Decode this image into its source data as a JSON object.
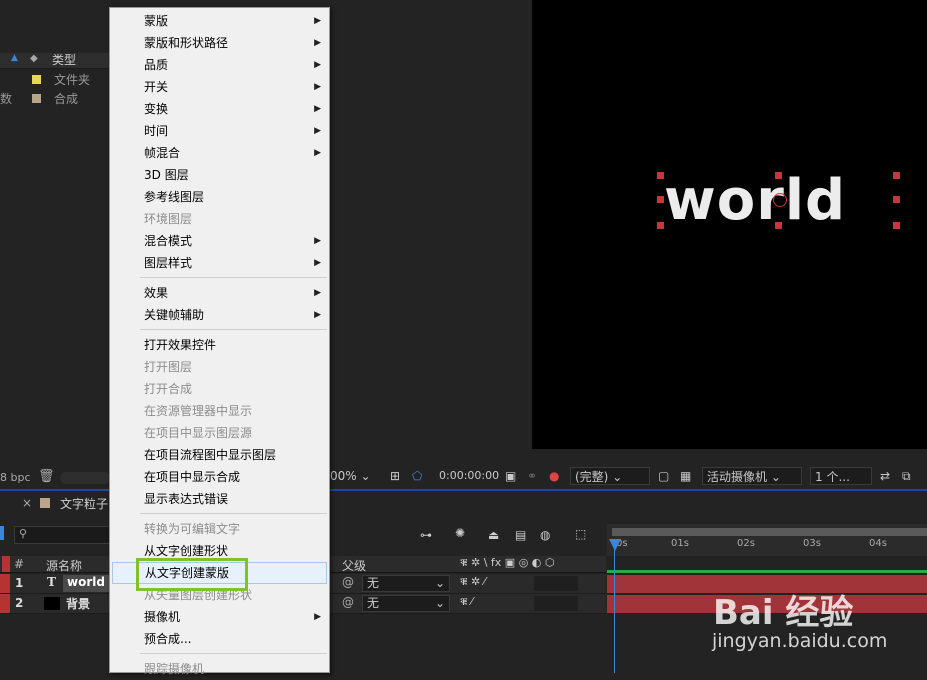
{
  "project_panel": {
    "col_type": "类型",
    "items": [
      {
        "type": "文件夹",
        "color": "#e6d75a"
      },
      {
        "type": "合成",
        "color": "#b8a58a"
      }
    ],
    "bpc": "8 bpc",
    "fragment_left": "数"
  },
  "viewer": {
    "comp_text": "world",
    "zoom_fragment": "00%",
    "timecode": "0:00:00:00",
    "resolution": "(完整)",
    "camera": "活动摄像机",
    "views": "1 个..."
  },
  "timeline": {
    "tab_label": "文字粒子",
    "col_num": "#",
    "col_source": "源名称",
    "col_parent": "父级",
    "layers": [
      {
        "num": "1",
        "type_glyph": "T",
        "name": "world",
        "parent": "无"
      },
      {
        "num": "2",
        "type_glyph": "",
        "name": "背景",
        "parent": "无"
      }
    ],
    "ticks": [
      "0s",
      "01s",
      "02s",
      "03s",
      "04s"
    ]
  },
  "context_menu": {
    "items": [
      {
        "label": "蒙版",
        "submenu": true,
        "disabled": false
      },
      {
        "label": "蒙版和形状路径",
        "submenu": true,
        "disabled": false
      },
      {
        "label": "品质",
        "submenu": true,
        "disabled": false
      },
      {
        "label": "开关",
        "submenu": true,
        "disabled": false
      },
      {
        "label": "变换",
        "submenu": true,
        "disabled": false
      },
      {
        "label": "时间",
        "submenu": true,
        "disabled": false
      },
      {
        "label": "帧混合",
        "submenu": true,
        "disabled": false
      },
      {
        "label": "3D 图层",
        "submenu": false,
        "disabled": false
      },
      {
        "label": "参考线图层",
        "submenu": false,
        "disabled": false
      },
      {
        "label": "环境图层",
        "submenu": false,
        "disabled": true
      },
      {
        "label": "混合模式",
        "submenu": true,
        "disabled": false
      },
      {
        "label": "图层样式",
        "submenu": true,
        "disabled": false
      },
      {
        "sep": true
      },
      {
        "label": "效果",
        "submenu": true,
        "disabled": false
      },
      {
        "label": "关键帧辅助",
        "submenu": true,
        "disabled": false
      },
      {
        "sep": true
      },
      {
        "label": "打开效果控件",
        "submenu": false,
        "disabled": false
      },
      {
        "label": "打开图层",
        "submenu": false,
        "disabled": true
      },
      {
        "label": "打开合成",
        "submenu": false,
        "disabled": true
      },
      {
        "label": "在资源管理器中显示",
        "submenu": false,
        "disabled": true
      },
      {
        "label": "在项目中显示图层源",
        "submenu": false,
        "disabled": true
      },
      {
        "label": "在项目流程图中显示图层",
        "submenu": false,
        "disabled": false
      },
      {
        "label": "在项目中显示合成",
        "submenu": false,
        "disabled": false
      },
      {
        "label": "显示表达式错误",
        "submenu": false,
        "disabled": false
      },
      {
        "sep": true
      },
      {
        "label": "转换为可编辑文字",
        "submenu": false,
        "disabled": true
      },
      {
        "label": "从文字创建形状",
        "submenu": false,
        "disabled": false
      },
      {
        "label": "从文字创建蒙版",
        "submenu": false,
        "disabled": false,
        "highlighted": true
      },
      {
        "label": "从矢量图层创建形状",
        "submenu": false,
        "disabled": true
      },
      {
        "label": "摄像机",
        "submenu": true,
        "disabled": false
      },
      {
        "label": "预合成...",
        "submenu": false,
        "disabled": false
      },
      {
        "sep": true
      },
      {
        "label": "跟踪摄像机",
        "submenu": false,
        "disabled": true
      }
    ]
  },
  "watermark": {
    "brand": "Bai 经验",
    "url": "jingyan.baidu.com"
  },
  "colors": {
    "layer_label": "#b63333",
    "track": "#a03438",
    "cti": "#3a86d8",
    "highlight_box": "#7ec521"
  }
}
